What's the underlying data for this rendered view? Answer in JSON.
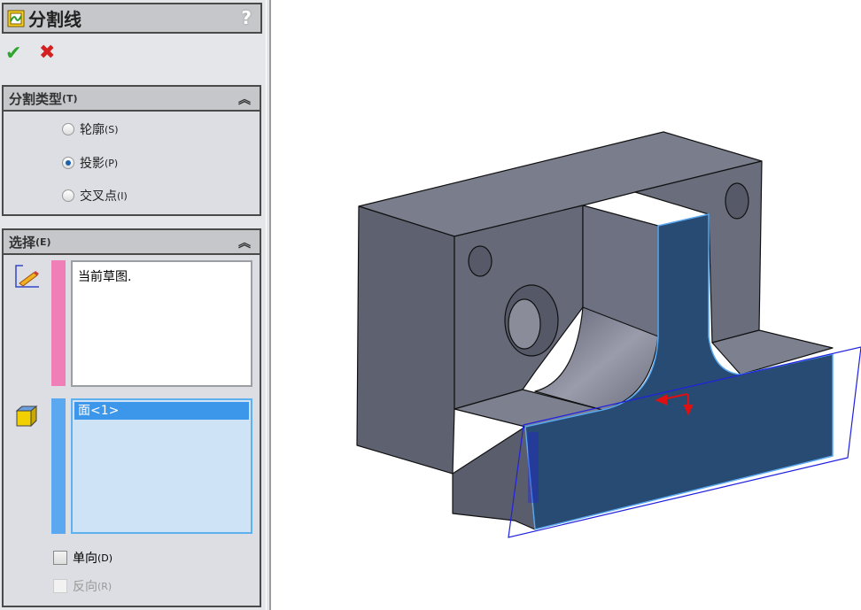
{
  "panel": {
    "title": "分割线",
    "help": "?",
    "ok_icon": "check-icon",
    "cancel_icon": "x-icon",
    "split_type": {
      "header": "分割类型",
      "header_key": "(T)",
      "options": [
        {
          "label": "轮廓",
          "key": "(S)",
          "selected": false
        },
        {
          "label": "投影",
          "key": "(P)",
          "selected": true
        },
        {
          "label": "交叉点",
          "key": "(I)",
          "selected": false
        }
      ]
    },
    "selection": {
      "header": "选择",
      "header_key": "(E)",
      "sketch_list": "当前草图.",
      "face_list_item": "面<1>",
      "single_direction": {
        "label": "单向",
        "key": "(D)",
        "checked": false
      },
      "reverse_direction": {
        "label": "反向",
        "key": "(R)",
        "checked": false,
        "enabled": false
      }
    }
  },
  "colors": {
    "sketch_stripe": "#f07fb8",
    "face_stripe": "#5aa8f0",
    "selected_face": "#284b74",
    "part": "#6b6e7e"
  }
}
